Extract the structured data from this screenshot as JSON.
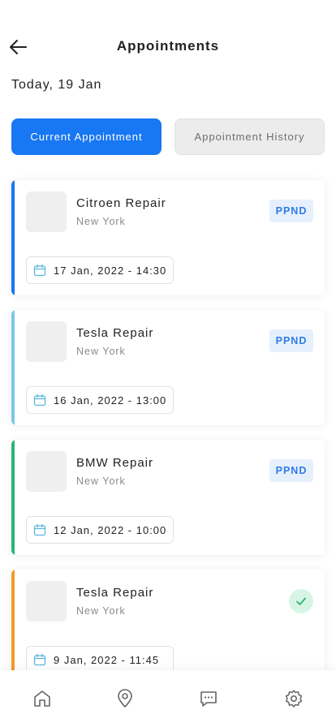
{
  "header": {
    "title": "Appointments",
    "back_icon": "arrow-left-icon"
  },
  "date_heading": "Today, 19 Jan",
  "tabs": [
    {
      "label": "Current Appointment",
      "active": true
    },
    {
      "label": "Appointment History",
      "active": false
    }
  ],
  "appointments": [
    {
      "name": "Citroen Repair",
      "location": "New York",
      "status": "PPND",
      "datetime": "17 Jan, 2022 - 14:30",
      "accent": "#1877f2"
    },
    {
      "name": "Tesla Repair",
      "location": "New York",
      "status": "PPND",
      "datetime": "16 Jan, 2022 - 13:00",
      "accent": "#7cc8e8"
    },
    {
      "name": "BMW Repair",
      "location": "New York",
      "status": "PPND",
      "datetime": "12 Jan, 2022 - 10:00",
      "accent": "#2bb673"
    },
    {
      "name": "Tesla Repair",
      "location": "New York",
      "status": "done",
      "datetime": "9 Jan, 2022 - 11:45",
      "accent": "#f39a2b"
    }
  ],
  "bottom_nav": [
    {
      "icon": "home-icon"
    },
    {
      "icon": "location-pin-icon"
    },
    {
      "icon": "chat-icon"
    },
    {
      "icon": "settings-gear-icon"
    }
  ],
  "colors": {
    "primary": "#1877f2",
    "badge_bg": "#e6f0fd",
    "badge_text": "#2f7be5",
    "done_bg": "#d7f5e6",
    "done_check": "#2bb673",
    "calendar_icon": "#5ab6dc"
  }
}
